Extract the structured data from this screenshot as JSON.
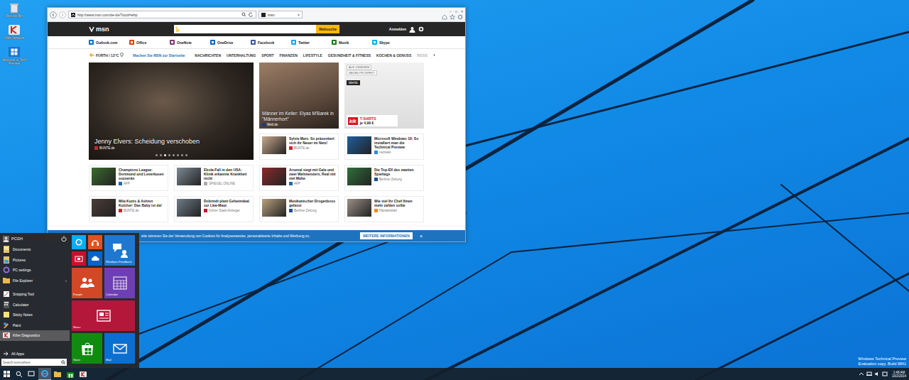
{
  "desktop_icons": [
    {
      "label": "Recycle Bin"
    },
    {
      "label": "Killer Network"
    },
    {
      "label": "Welcome to Tech Preview"
    }
  ],
  "browser": {
    "address": "http://www.msn.com/de-de/?ocid=iehp",
    "tab": "msn",
    "tab_close": "×",
    "controls": [
      "–",
      "□",
      "×"
    ],
    "header": {
      "logo": "msn",
      "search_button": "Websuche",
      "signin": "Anmelden"
    },
    "links": [
      "Outlook.com",
      "Office",
      "OneNote",
      "OneDrive",
      "Facebook",
      "Twitter",
      "Musik",
      "Skype"
    ],
    "nav": {
      "weather": "FÜRTH / 12°C",
      "homepage": "Machen Sie MSN zur Startseite",
      "categories": [
        {
          "label": "NACHRICHTEN",
          "faded": false
        },
        {
          "label": "UNTERHALTUNG",
          "faded": false
        },
        {
          "label": "SPORT",
          "faded": false
        },
        {
          "label": "FINANZEN",
          "faded": false
        },
        {
          "label": "LIFESTYLE",
          "faded": false
        },
        {
          "label": "GESUNDHEIT & FITNESS",
          "faded": false
        },
        {
          "label": "KOCHEN & GENUSS",
          "faded": false
        },
        {
          "label": "REISE",
          "faded": true
        }
      ],
      "next": "›"
    },
    "hero": {
      "title": "Jenny Elvers: Scheidung verschoben",
      "source": "BUNTE.de",
      "slides": [
        {
          "selected": false
        },
        {
          "selected": false
        },
        {
          "selected": true
        },
        {
          "selected": false
        },
        {
          "selected": false
        },
        {
          "selected": false
        },
        {
          "selected": false
        },
        {
          "selected": false
        }
      ]
    },
    "feature": {
      "title": "Männer im Keller: Elyas M'Barek in \"Männerhort\"",
      "source": "Welt.de"
    },
    "ad": {
      "badge": [
        "AUS UNSEREM",
        "NEUEN PROSPEKT"
      ],
      "brand": "identic",
      "logo": "kik",
      "offer": "T-SHIRTS",
      "price": "je 4,99 €"
    },
    "stories": [
      {
        "title": "Sylvie Meis: So präsentiert sich ihr Neuer im Netz!",
        "source": "BUNTE.de"
      },
      {
        "title": "Microsoft Windows 10: So installiert man die Technical Preview",
        "source": "netzwelt"
      },
      {
        "title": "Champions League: Dortmund und Leverkusen souverän",
        "source": "AFP"
      },
      {
        "title": "Ebola-Fall in den USA: Klinik erkannte Krankheit nicht",
        "source": "SPIEGEL ONLINE"
      },
      {
        "title": "Arsenal siegt mit Gala und zwei Weltmeistern, Real mit viel Mühe",
        "source": "AFP"
      },
      {
        "title": "Die Top-Elf des zweiten Spieltags",
        "source": "Berliner Zeitung"
      },
      {
        "title": "Mila Kunis & Ashton Kutcher: Das Baby ist da!",
        "source": "BUNTE.de"
      },
      {
        "title": "Dobrindt plant Geheimdeal zur Lkw-Maut",
        "source": "Kölner Stadt-Anzeiger"
      },
      {
        "title": "Mexikanischer Drogenboss gefasst",
        "source": "Berliner Zeitung"
      },
      {
        "title": "Wie viel Ihr Chef Ihnen mehr zahlen sollte",
        "source": "Handelsblatt"
      }
    ],
    "cookie": {
      "text": "eite stimmen Sie der Verwendung von Cookies für Analysezwecke, personalisierte Inhalte und Werbung zu.",
      "button": "WEITERE INFORMATIONEN",
      "close": "×"
    }
  },
  "start_menu": {
    "user": "PCGH",
    "items": [
      {
        "label": "Documents",
        "kind": "place",
        "selected": false
      },
      {
        "label": "Pictures",
        "kind": "place",
        "selected": false
      },
      {
        "label": "PC settings",
        "kind": "place",
        "selected": false
      },
      {
        "label": "File Explorer",
        "kind": "place",
        "selected": false,
        "chevron": "›"
      },
      {
        "label": "Snipping Tool",
        "kind": "app",
        "selected": false
      },
      {
        "label": "Calculator",
        "kind": "app",
        "selected": false
      },
      {
        "label": "Sticky Notes",
        "kind": "app",
        "selected": false
      },
      {
        "label": "Paint",
        "kind": "app",
        "selected": false
      },
      {
        "label": "Killer Diagnostics",
        "kind": "app",
        "selected": true
      }
    ],
    "all_apps": "All Apps",
    "search": "Search everywhere",
    "tiles": [
      {
        "kind": "small",
        "color": "#00aff0"
      },
      {
        "kind": "small",
        "color": "#e2521d"
      },
      {
        "kind": "medium",
        "color": "#1e78d2",
        "label": "Windows Feedback"
      },
      {
        "kind": "small",
        "color": "#c8102e"
      },
      {
        "kind": "small",
        "color": "#0a64c8"
      },
      {
        "kind": "medium",
        "color": "#d24726",
        "label": "People"
      },
      {
        "kind": "medium",
        "color": "#6e3fb4",
        "label": "Calendar"
      },
      {
        "kind": "wide",
        "color": "#b5173a",
        "label": "News"
      },
      {
        "kind": "medium",
        "color": "#128a12",
        "label": "Store"
      },
      {
        "kind": "medium",
        "color": "#0a6fd2",
        "label": "Mail"
      }
    ]
  },
  "taskbar": {
    "apps": [
      {
        "selected": false
      },
      {
        "selected": true
      },
      {
        "selected": false
      },
      {
        "selected": false
      },
      {
        "selected": false
      }
    ],
    "time": "1:48 AM",
    "date": "10/2/2014"
  },
  "watermark": [
    "Windows Technical Preview",
    "Evaluation copy. Build 9841"
  ]
}
